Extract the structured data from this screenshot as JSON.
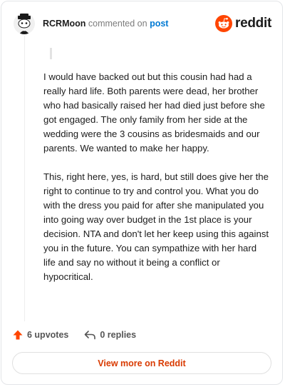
{
  "header": {
    "username": "RCRMoon",
    "action": "commented on",
    "post_link": "post",
    "brand_name": "reddit",
    "brand_color": "#ff4500"
  },
  "comment": {
    "paragraphs": [
      "I would have backed out but this cousin had had a really hard life. Both parents were dead, her brother who had basically raised her had died just before she got engaged. The only family from her side at the wedding were the 3 cousins as bridesmaids and our parents. We wanted to make her happy.",
      "This, right here, yes, is hard, but still does give her the right to continue to try and control you. What you do with the dress you paid for after she manipulated you into going way over budget in the 1st place is your decision. NTA and don't let her keep using this against you in the future. You can sympathize with her hard life and say no without it being a conflict or hypocritical."
    ]
  },
  "actions": {
    "upvotes_label": "6 upvotes",
    "replies_label": "0 replies",
    "upvote_icon": "upvote-arrow-icon",
    "reply_icon": "reply-arrow-icon",
    "upvote_color": "#ff4500"
  },
  "footer": {
    "view_more_label": "View more on Reddit"
  }
}
